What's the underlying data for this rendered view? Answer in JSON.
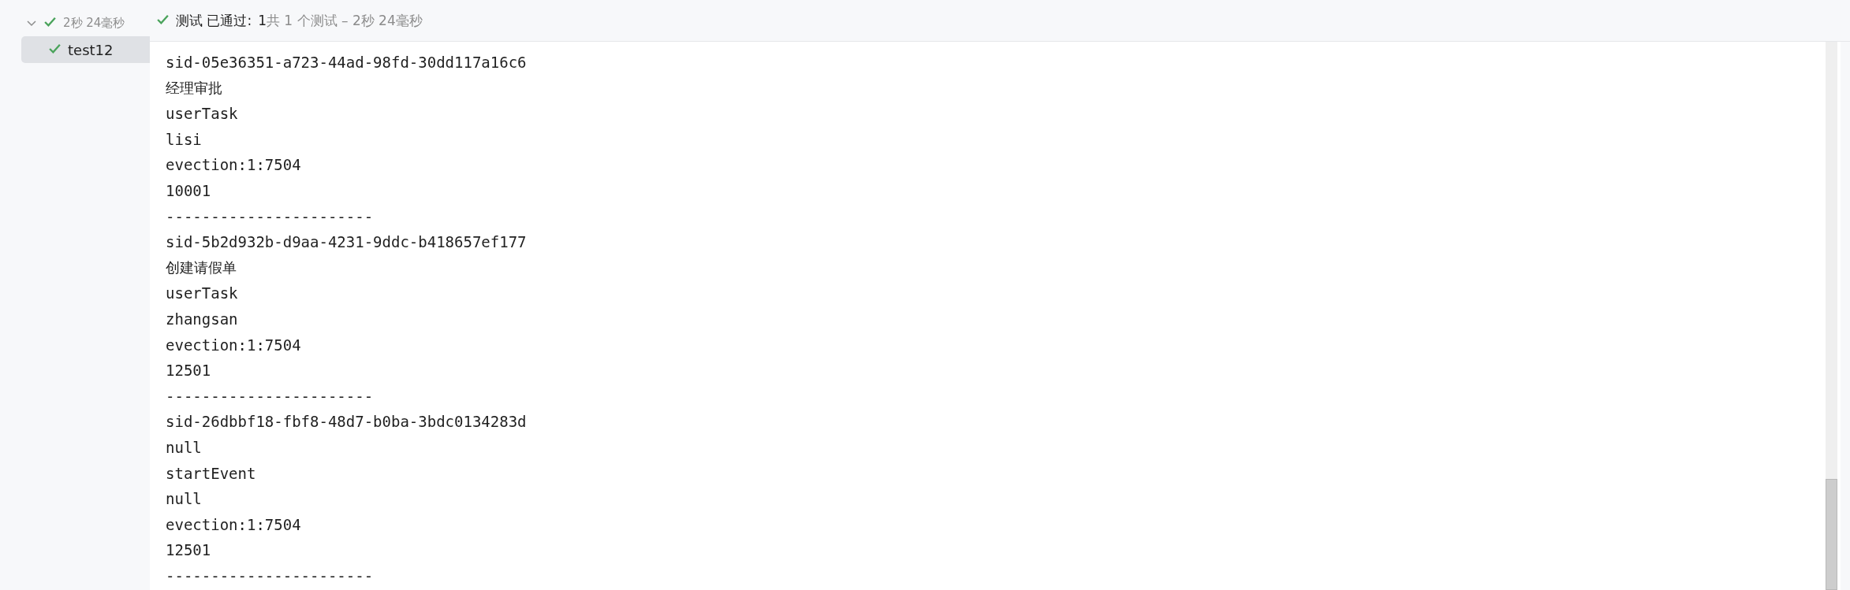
{
  "test_tree": [
    {
      "label": "2秒 24毫秒",
      "passed": true,
      "expanded": true,
      "selected": false,
      "children": [
        {
          "label": "test12",
          "passed": true,
          "selected": true
        }
      ]
    }
  ],
  "header": {
    "passed": true,
    "title": "测试 已通过:",
    "passed_count": "1",
    "summary": "共 1 个测试 – 2秒 24毫秒"
  },
  "console_lines": [
    "sid-05e36351-a723-44ad-98fd-30dd117a16c6",
    "经理审批",
    "userTask",
    "lisi",
    "evection:1:7504",
    "10001",
    "-----------------------",
    "sid-5b2d932b-d9aa-4231-9ddc-b418657ef177",
    "创建请假单",
    "userTask",
    "zhangsan",
    "evection:1:7504",
    "12501",
    "-----------------------",
    "sid-26dbbf18-fbf8-48d7-b0ba-3bdc0134283d",
    "null",
    "startEvent",
    "null",
    "evection:1:7504",
    "12501",
    "-----------------------"
  ]
}
